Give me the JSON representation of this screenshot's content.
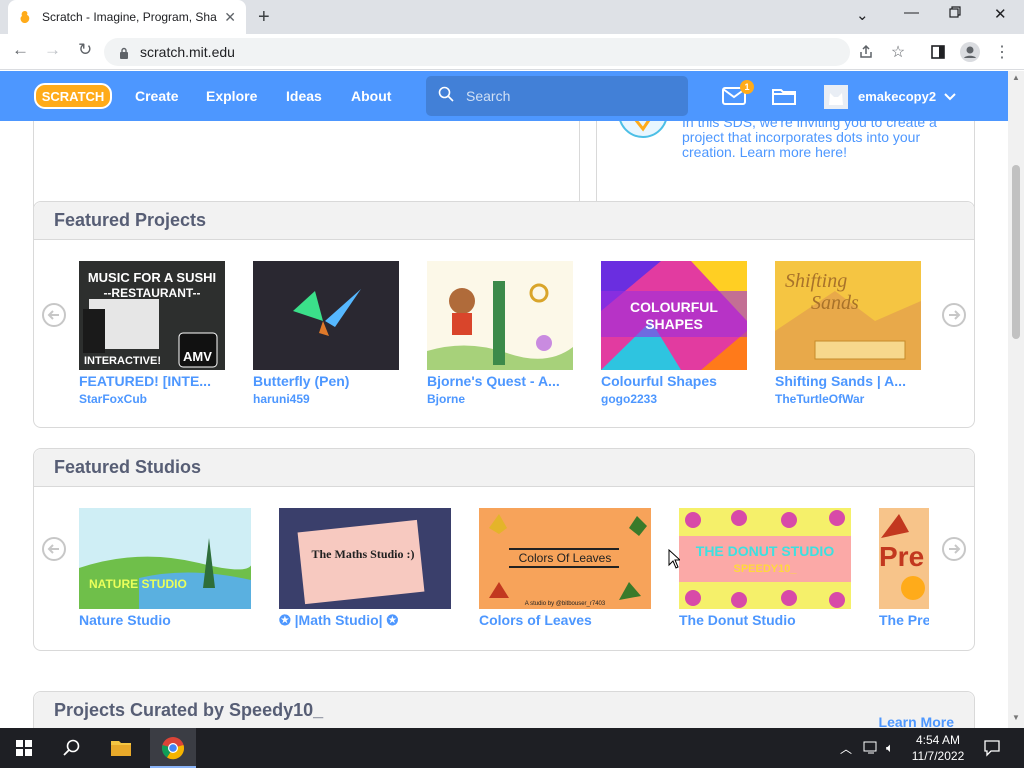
{
  "browser": {
    "tab_title": "Scratch - Imagine, Program, Sha",
    "url": "scratch.mit.edu"
  },
  "navbar": {
    "logo": "SCRATCH",
    "links": [
      "Create",
      "Explore",
      "Ideas",
      "About"
    ],
    "search_placeholder": "Search",
    "message_count": "1",
    "username": "emakecopy2"
  },
  "top_card": {
    "text": "In this SDS, we're inviting you to create a project that incorporates dots into your creation. Learn more here!"
  },
  "featured_projects": {
    "title": "Featured Projects",
    "items": [
      {
        "title": "FEATURED! [INTE...",
        "author": "StarFoxCub",
        "thumb_text": [
          "MUSIC FOR A SUSHI",
          "--RESTAURANT--",
          "INTERACTIVE!",
          "AMV"
        ]
      },
      {
        "title": "Butterfly (Pen)",
        "author": "haruni459"
      },
      {
        "title": "Bjorne's Quest - A...",
        "author": "Bjorne"
      },
      {
        "title": "Colourful Shapes",
        "author": "gogo2233",
        "thumb_text": [
          "COLOURFUL",
          "SHAPES"
        ]
      },
      {
        "title": "Shifting Sands | A...",
        "author": "TheTurtleOfWar",
        "thumb_text": [
          "Shifting",
          "Sands"
        ]
      }
    ]
  },
  "featured_studios": {
    "title": "Featured Studios",
    "items": [
      {
        "title": "Nature Studio",
        "thumb_text": "NATURE STUDIO"
      },
      {
        "title": "✪ |Math Studio| ✪",
        "thumb_text": "The Maths Studio :)"
      },
      {
        "title": "Colors of Leaves",
        "thumb_text": "Colors Of Leaves",
        "thumb_sub": "A studio by @bitbouser_r7403"
      },
      {
        "title": "The Donut Studio",
        "thumb_text": "THE DONUT STUDIO",
        "thumb_sub": "SPEEDY10_"
      },
      {
        "title": "The Pre",
        "thumb_text": "Pre"
      }
    ]
  },
  "curated": {
    "title": "Projects Curated by Speedy10_",
    "learn_more": "Learn More"
  },
  "taskbar": {
    "time": "4:54 AM",
    "date": "11/7/2022"
  }
}
